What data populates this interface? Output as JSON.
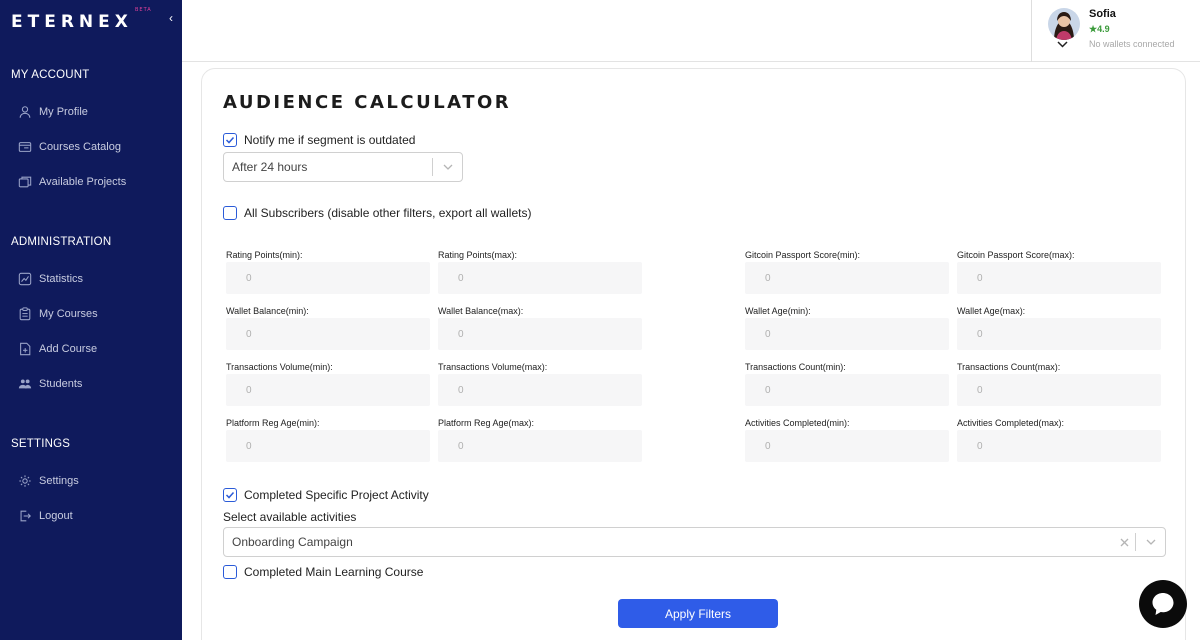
{
  "brand": {
    "name": "ETERNEX",
    "badge": "BETA"
  },
  "sidebar": {
    "sections": [
      {
        "title": "MY ACCOUNT",
        "items": [
          {
            "label": "My Profile",
            "icon": "user-icon"
          },
          {
            "label": "Courses Catalog",
            "icon": "catalog-icon"
          },
          {
            "label": "Available Projects",
            "icon": "projects-icon"
          }
        ]
      },
      {
        "title": "ADMINISTRATION",
        "items": [
          {
            "label": "Statistics",
            "icon": "chart-icon"
          },
          {
            "label": "My Courses",
            "icon": "clipboard-icon"
          },
          {
            "label": "Add Course",
            "icon": "add-document-icon"
          },
          {
            "label": "Students",
            "icon": "students-icon"
          }
        ]
      },
      {
        "title": "SETTINGS",
        "items": [
          {
            "label": "Settings",
            "icon": "gear-icon"
          },
          {
            "label": "Logout",
            "icon": "logout-icon"
          }
        ]
      }
    ]
  },
  "profile": {
    "name": "Sofia",
    "rating": "★4.9",
    "wallet_status": "No wallets connected"
  },
  "main": {
    "title": "AUDIENCE CALCULATOR",
    "notify": {
      "label": "Notify me if segment is outdated",
      "checked": true
    },
    "notify_select": {
      "value": "After 24 hours"
    },
    "all_subscribers": {
      "label": "All Subscribers (disable other filters, export all wallets)",
      "checked": false
    },
    "fields": [
      {
        "label": "Rating Points(min):",
        "placeholder": "0"
      },
      {
        "label": "Rating Points(max):",
        "placeholder": "0"
      },
      {
        "label": "Gitcoin Passport Score(min):",
        "placeholder": "0"
      },
      {
        "label": "Gitcoin Passport Score(max):",
        "placeholder": "0"
      },
      {
        "label": "Wallet Balance(min):",
        "placeholder": "0"
      },
      {
        "label": "Wallet Balance(max):",
        "placeholder": "0"
      },
      {
        "label": "Wallet Age(min):",
        "placeholder": "0"
      },
      {
        "label": "Wallet Age(max):",
        "placeholder": "0"
      },
      {
        "label": "Transactions Volume(min):",
        "placeholder": "0"
      },
      {
        "label": "Transactions Volume(max):",
        "placeholder": "0"
      },
      {
        "label": "Transactions Count(min):",
        "placeholder": "0"
      },
      {
        "label": "Transactions Count(max):",
        "placeholder": "0"
      },
      {
        "label": "Platform Reg Age(min):",
        "placeholder": "0"
      },
      {
        "label": "Platform Reg Age(max):",
        "placeholder": "0"
      },
      {
        "label": "Activities Completed(min):",
        "placeholder": "0"
      },
      {
        "label": "Activities Completed(max):",
        "placeholder": "0"
      }
    ],
    "project_activity": {
      "label": "Completed Specific Project Activity",
      "checked": true
    },
    "activities_label": "Select available activities",
    "activities_select": {
      "value": "Onboarding Campaign"
    },
    "main_course": {
      "label": "Completed Main Learning Course",
      "checked": false
    },
    "apply_label": "Apply Filters"
  },
  "colors": {
    "sidebar_bg": "#0f1a5c",
    "accent": "#2f5ce8",
    "checkbox": "#2b5bd8",
    "rating": "#3a9a3a"
  }
}
